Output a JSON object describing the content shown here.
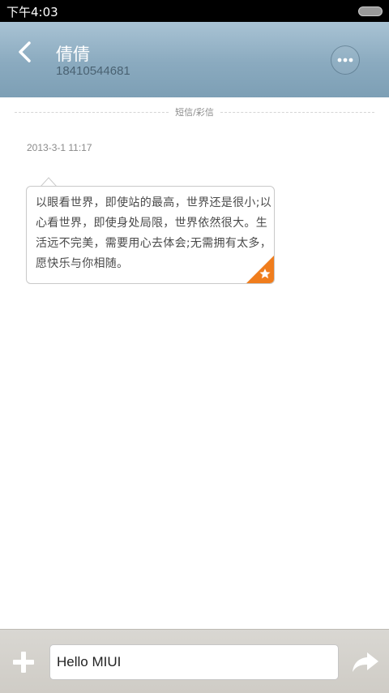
{
  "status_bar": {
    "time": "下午4:03"
  },
  "header": {
    "contact_name": "倩倩",
    "contact_number": "18410544681"
  },
  "divider": {
    "label": "短信/彩信"
  },
  "messages": [
    {
      "timestamp": "2013-3-1 11:17",
      "text": "以眼看世界，即使站的最高，世界还是很小;以心看世界，即使身处局限，世界依然很大。生活远不完美，需要用心去体会;无需拥有太多，愿快乐与你相随。",
      "starred": true
    }
  ],
  "compose": {
    "value": "Hello MIUI"
  },
  "colors": {
    "header_accent": "#8aaabf",
    "star_badge": "#f07d1d"
  },
  "icons": {
    "back": "back-chevron-icon",
    "more": "more-dots-icon",
    "star": "star-icon",
    "add": "plus-icon",
    "send": "send-arrow-icon"
  }
}
